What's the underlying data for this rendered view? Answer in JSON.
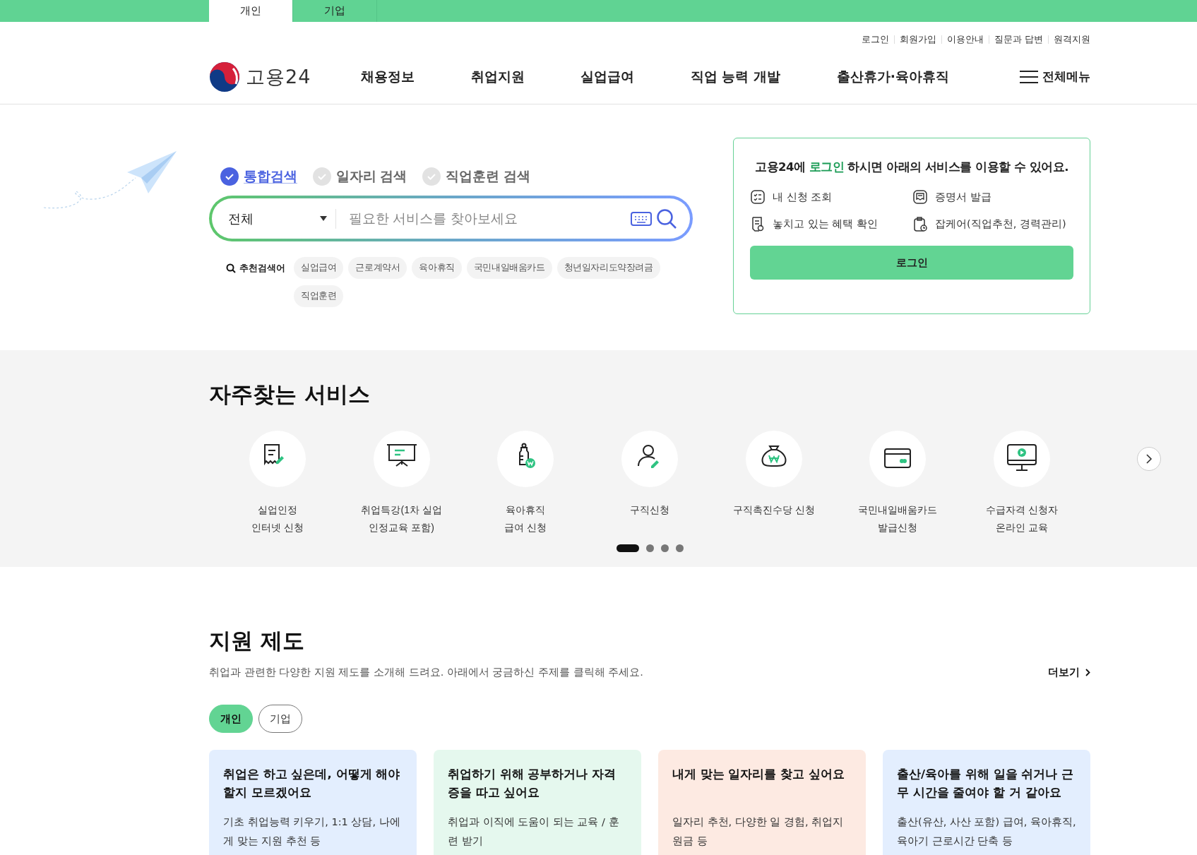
{
  "top_tabs": [
    {
      "label": "개인",
      "selected": true
    },
    {
      "label": "기업",
      "selected": false
    }
  ],
  "utility_links": [
    "로그인",
    "회원가입",
    "이용안내",
    "질문과 답변",
    "원격지원"
  ],
  "logo": {
    "text": "고용24"
  },
  "nav": [
    "채용정보",
    "취업지원",
    "실업급여",
    "직업 능력 개발",
    "출산휴가·육아휴직"
  ],
  "all_menu": "전체메뉴",
  "search": {
    "tabs": [
      {
        "label": "통합검색",
        "selected": true
      },
      {
        "label": "일자리 검색",
        "selected": false
      },
      {
        "label": "직업훈련 검색",
        "selected": false
      }
    ],
    "scope": "전체",
    "placeholder": "필요한 서비스를 찾아보세요",
    "recommend_label": "추천검색어",
    "keywords": [
      "실업급여",
      "근로계약서",
      "육아휴직",
      "국민내일배움카드",
      "청년일자리도약장려금",
      "직업훈련"
    ]
  },
  "login_card": {
    "title": [
      {
        "text": "고용24에 ",
        "highlight": false
      },
      {
        "text": "로그인",
        "highlight": true
      },
      {
        "text": " 하시면 아래의 서비스를 이용할 수 있어요.",
        "highlight": false
      }
    ],
    "services": [
      "내 신청 조회",
      "증명서 발급",
      "놓치고 있는 혜택 확인",
      "잡케어(직업추천, 경력관리)"
    ],
    "button": "로그인"
  },
  "frequent": {
    "title": "자주찾는 서비스",
    "items": [
      {
        "label": "실업인정\n인터넷 신청"
      },
      {
        "label": "취업특강(1차 실업\n인정교육 포함)"
      },
      {
        "label": "육아휴직\n급여 신청"
      },
      {
        "label": "구직신청"
      },
      {
        "label": "구직촉진수당 신청"
      },
      {
        "label": "국민내일배움카드\n발급신청"
      },
      {
        "label": "수급자격 신청자\n온라인 교육"
      }
    ],
    "pages": [
      {
        "selected": true
      },
      {
        "selected": false
      },
      {
        "selected": false
      },
      {
        "selected": false
      }
    ]
  },
  "support": {
    "title": "지원 제도",
    "description": "취업과 관련한 다양한 지원 제도를 소개해 드려요. 아래에서 궁금하신 주제를 클릭해 주세요.",
    "more": "더보기",
    "tabs": [
      {
        "label": "개인",
        "selected": true
      },
      {
        "label": "기업",
        "selected": false
      }
    ],
    "cards": [
      {
        "title": "취업은 하고 싶은데, 어떻게 해야 할지 모르겠어요",
        "text": "기초 취업능력 키우기, 1:1 상담, 나에게 맞는 지원 추천 등",
        "color": "#e3eefe"
      },
      {
        "title": "취업하기 위해 공부하거나 자격증을 따고 싶어요",
        "text": "취업과 이직에 도움이 되는 교육 / 훈련 받기",
        "color": "#e5f8ee"
      },
      {
        "title": "내게 맞는 일자리를 찾고 싶어요",
        "text": "일자리 추천, 다양한 일 경험, 취업지원금 등",
        "color": "#fdeae2"
      },
      {
        "title": "출산/육아를 위해 일을 쉬거나 근무 시간을 줄여야 할 거 같아요",
        "text": "출산(유산, 사산 포함) 급여, 육아휴직, 육아기 근로시간 단축 등",
        "color": "#e3eefe"
      }
    ]
  }
}
